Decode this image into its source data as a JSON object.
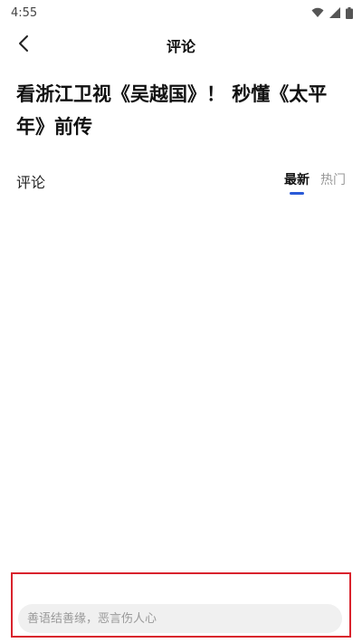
{
  "status_bar": {
    "time": "4:55",
    "icons": [
      "wifi-icon",
      "signal-icon",
      "battery-icon"
    ]
  },
  "app_bar": {
    "back_icon": "chevron-left-icon",
    "title": "评论"
  },
  "article": {
    "title": "看浙江卫视《吴越国》！ 秒懂《太平年》前传"
  },
  "comments": {
    "label": "评论",
    "sort_tabs": [
      {
        "label": "最新",
        "active": true
      },
      {
        "label": "热门",
        "active": false
      }
    ]
  },
  "comment_input": {
    "placeholder": "善语结善缘，恶言伤人心",
    "value": ""
  },
  "colors": {
    "accent": "#2a5ad7",
    "highlight_border": "#d9232d",
    "input_bg": "#f0f0f0"
  }
}
